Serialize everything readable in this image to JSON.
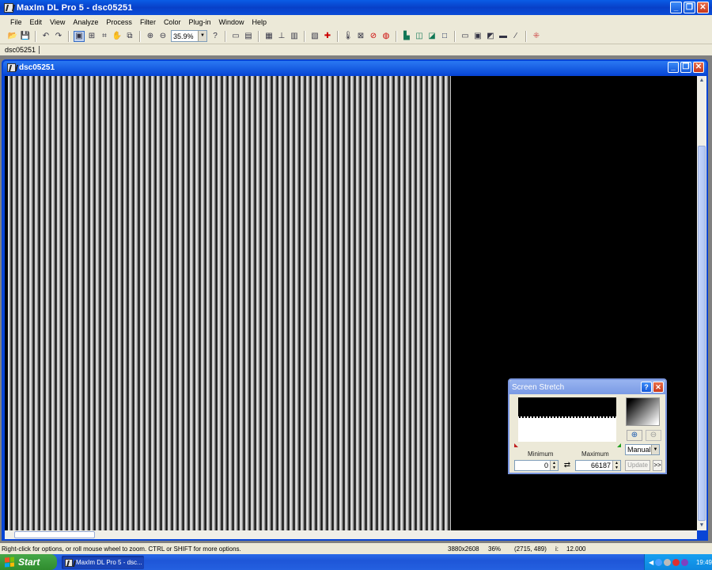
{
  "app": {
    "title": "MaxIm DL Pro 5 - dsc05251",
    "min_glyph": "_",
    "restore_glyph": "❐",
    "close_glyph": "✕"
  },
  "menu": [
    "File",
    "Edit",
    "View",
    "Analyze",
    "Process",
    "Filter",
    "Color",
    "Plug-in",
    "Window",
    "Help"
  ],
  "toolbar": {
    "zoom_value": "35.9%",
    "icons": [
      "open-icon",
      "save-icon",
      "undo-icon",
      "redo-icon",
      "image-view-icon",
      "fit-icon",
      "crop-icon",
      "pan-icon",
      "copy-icon",
      "zoom-in-icon",
      "zoom-out-icon",
      "help-icon",
      "measure-icon",
      "stack-icon",
      "calibrate-icon",
      "align-icon",
      "info-icon",
      "crosshair-icon",
      "pick-icon",
      "add-icon",
      "color-icon",
      "filter-icon",
      "histogram-icon",
      "layers-icon",
      "blink-icon",
      "rect-icon",
      "window-icon",
      "screen-icon",
      "graph-icon",
      "line-icon",
      "plot-icon",
      "star-icon"
    ]
  },
  "doc_tabs": [
    "dsc05251"
  ],
  "child_window": {
    "title": "dsc05251"
  },
  "screen_stretch": {
    "title": "Screen Stretch",
    "help_glyph": "?",
    "minimum_label": "Minimum",
    "maximum_label": "Maximum",
    "minimum_value": "0",
    "maximum_value": "66187",
    "mode": "Manual",
    "update_label": "Update",
    "more_label": ">>"
  },
  "status": {
    "hint": "Right-click for options, or roll mouse wheel to zoom. CTRL or SHIFT for more options.",
    "dimensions": "3880x2608",
    "zoom": "36%",
    "coords": "(2715, 489)",
    "i_label": "i:",
    "value": "12.000"
  },
  "taskbar": {
    "start_label": "Start",
    "task_label": "MaxIm DL Pro 5 - dsc...",
    "clock": "19:49"
  },
  "colors": {
    "titlebar": "#0a4cd8",
    "taskbar": "#1e56d8",
    "start": "#3a9c3a",
    "tray": "#0e88e0",
    "workspace": "#808080"
  }
}
